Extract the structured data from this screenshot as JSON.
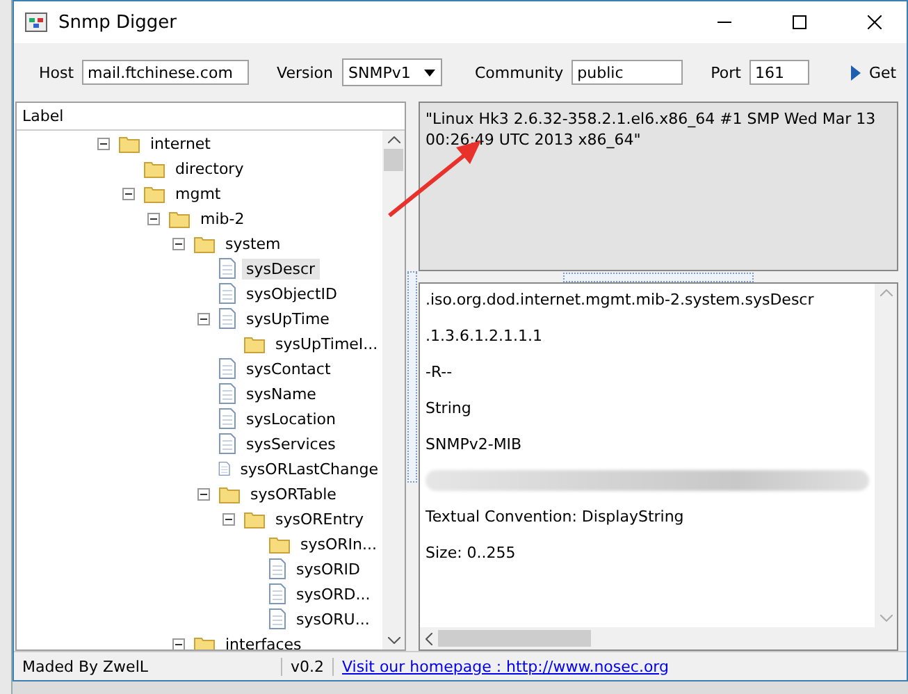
{
  "window": {
    "title": "Snmp Digger"
  },
  "toolbar": {
    "host_label": "Host",
    "host": "mail.ftchinese.com",
    "version_label": "Version",
    "version": "SNMPv1",
    "community_label": "Community",
    "community": "public",
    "port_label": "Port",
    "port": "161",
    "get_button": "Get"
  },
  "tree": {
    "header": "Label",
    "nodes": [
      {
        "label": "internet",
        "kind": "folder",
        "expanded": true,
        "selected": false,
        "children": [
          {
            "label": "directory",
            "kind": "folder",
            "selected": false
          },
          {
            "label": "mgmt",
            "kind": "folder",
            "expanded": true,
            "selected": false,
            "children": [
              {
                "label": "mib-2",
                "kind": "folder",
                "expanded": true,
                "selected": false,
                "children": [
                  {
                    "label": "system",
                    "kind": "folder",
                    "expanded": true,
                    "selected": false,
                    "children": [
                      {
                        "label": "sysDescr",
                        "kind": "file",
                        "selected": true
                      },
                      {
                        "label": "sysObjectID",
                        "kind": "file",
                        "selected": false
                      },
                      {
                        "label": "sysUpTime",
                        "kind": "file",
                        "expanded": true,
                        "selected": false,
                        "children": [
                          {
                            "label": "sysUpTimeI...",
                            "kind": "folder",
                            "selected": false
                          }
                        ]
                      },
                      {
                        "label": "sysContact",
                        "kind": "file",
                        "selected": false
                      },
                      {
                        "label": "sysName",
                        "kind": "file",
                        "selected": false
                      },
                      {
                        "label": "sysLocation",
                        "kind": "file",
                        "selected": false
                      },
                      {
                        "label": "sysServices",
                        "kind": "file",
                        "selected": false
                      },
                      {
                        "label": "sysORLastChange",
                        "kind": "file",
                        "selected": false
                      },
                      {
                        "label": "sysORTable",
                        "kind": "folder",
                        "expanded": true,
                        "selected": false,
                        "children": [
                          {
                            "label": "sysOREntry",
                            "kind": "folder",
                            "expanded": true,
                            "selected": false,
                            "children": [
                              {
                                "label": "sysORIn...",
                                "kind": "folder",
                                "selected": false
                              },
                              {
                                "label": "sysORID",
                                "kind": "file",
                                "selected": false
                              },
                              {
                                "label": "sysORD...",
                                "kind": "file",
                                "selected": false
                              },
                              {
                                "label": "sysORU...",
                                "kind": "file",
                                "selected": false
                              }
                            ]
                          }
                        ]
                      }
                    ]
                  },
                  {
                    "label": "interfaces",
                    "kind": "folder",
                    "expanded": true,
                    "selected": false
                  }
                ]
              }
            ]
          }
        ]
      }
    ]
  },
  "value_box": {
    "text": "\"Linux Hk3 2.6.32-358.2.1.el6.x86_64 #1 SMP Wed Mar 13 00:26:49 UTC 2013 x86_64\""
  },
  "details": [
    {
      "kind": "text",
      "text": ".iso.org.dod.internet.mgmt.mib-2.system.sysDescr"
    },
    {
      "kind": "text",
      "text": ".1.3.6.1.2.1.1.1"
    },
    {
      "kind": "text",
      "text": "-R--"
    },
    {
      "kind": "text",
      "text": "String"
    },
    {
      "kind": "text",
      "text": "SNMPv2-MIB"
    },
    {
      "kind": "redacted"
    },
    {
      "kind": "text",
      "text": "Textual Convention: DisplayString"
    },
    {
      "kind": "text",
      "text": "Size: 0..255"
    }
  ],
  "status_bar": {
    "author": "Maded By ZwelL",
    "version": "v0.2",
    "link": "Visit our homepage : http://www.nosec.org"
  }
}
